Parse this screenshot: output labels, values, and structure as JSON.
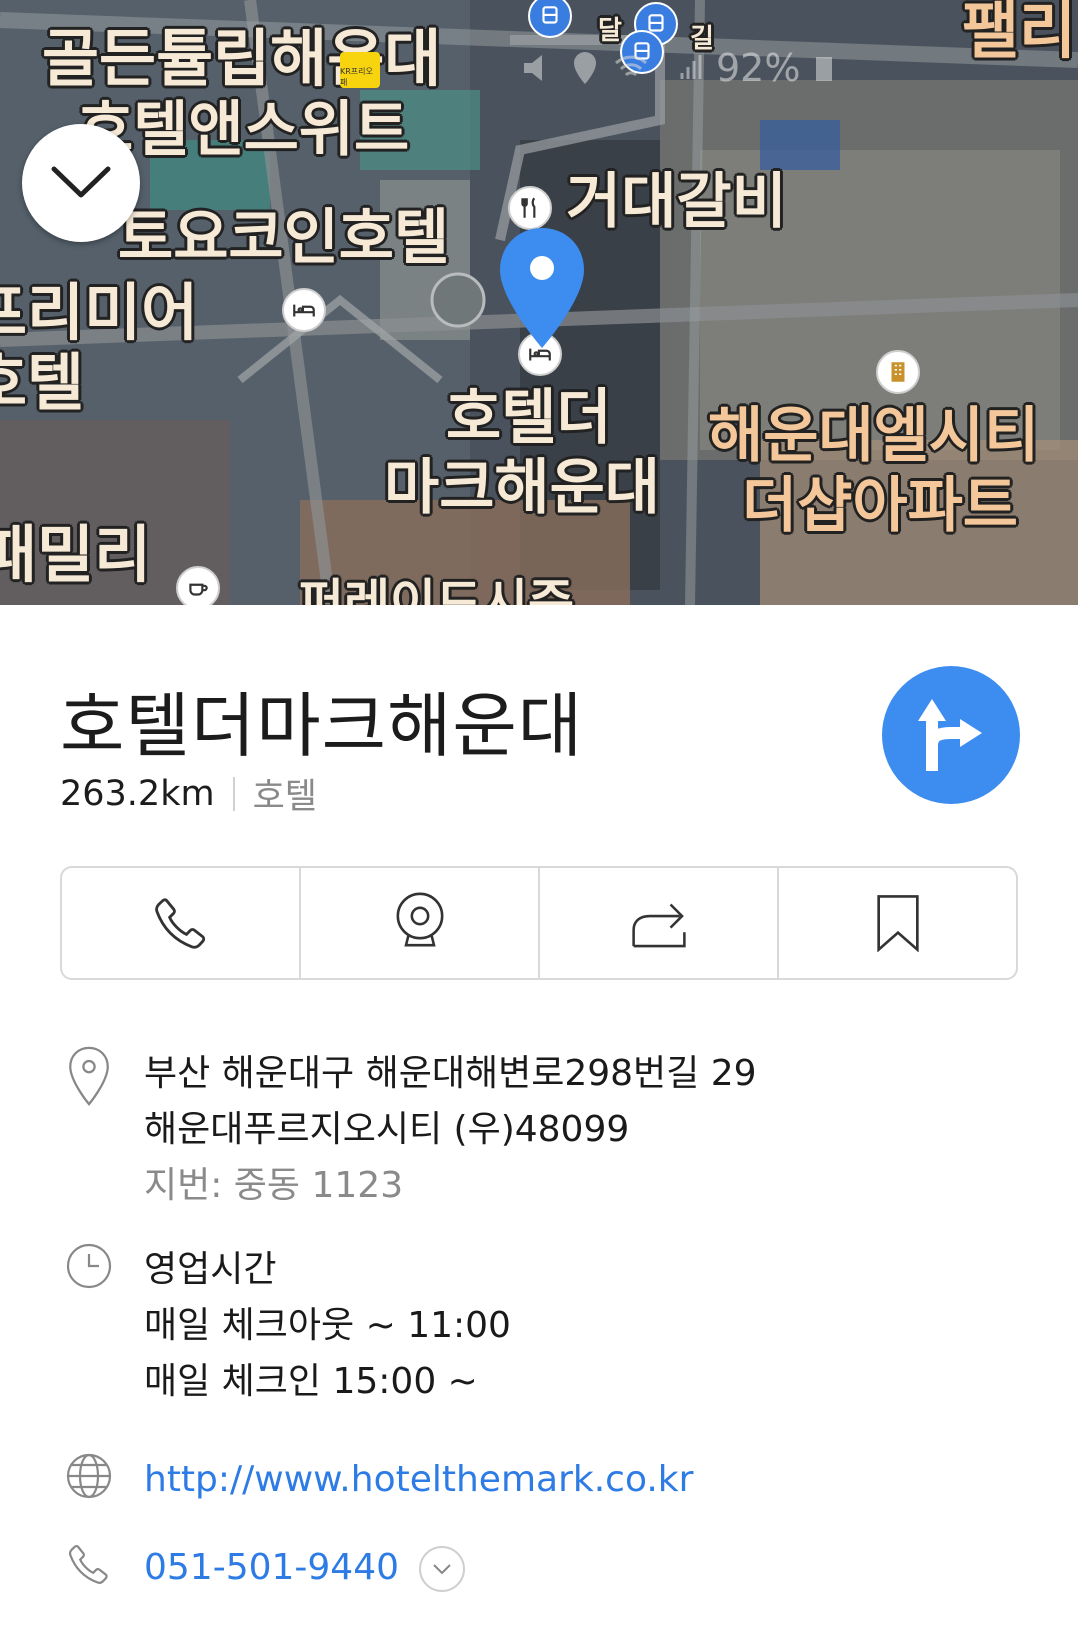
{
  "map": {
    "labels": [
      {
        "id": "golden-tulip-line1",
        "text": "골든튤립해운대"
      },
      {
        "id": "golden-tulip-line2",
        "text": "호텔앤스위트"
      },
      {
        "id": "toyoko-inn",
        "text": "토요코인호텔"
      },
      {
        "id": "premier-line1",
        "text": "프리미어"
      },
      {
        "id": "premier-line2",
        "text": "호텔"
      },
      {
        "id": "geodae-galbi",
        "text": "거대갈비"
      },
      {
        "id": "hotel-the-mark-line1",
        "text": "호텔더"
      },
      {
        "id": "hotel-the-mark-line2",
        "text": "마크해운대"
      },
      {
        "id": "elcity-line1",
        "text": "해운대엘시티"
      },
      {
        "id": "elcity-line2",
        "text": "더샵아파트"
      },
      {
        "id": "family",
        "text": "패밀리"
      },
      {
        "id": "palace",
        "text": "팰리"
      },
      {
        "id": "road-dal",
        "text": "달"
      },
      {
        "id": "road-gil",
        "text": "길"
      },
      {
        "id": "parade",
        "text": "퍼레이드시즌"
      }
    ],
    "status": {
      "battery": "92%"
    },
    "chip_text": "KR프리오패"
  },
  "place": {
    "name": "호텔더마크해운대",
    "distance": "263.2km",
    "category": "호텔"
  },
  "actions": [
    {
      "id": "call",
      "icon": "phone-icon"
    },
    {
      "id": "roadview",
      "icon": "webcam-icon"
    },
    {
      "id": "share",
      "icon": "share-icon"
    },
    {
      "id": "save",
      "icon": "bookmark-icon"
    }
  ],
  "info": {
    "address_line1": "부산 해운대구 해운대해변로298번길 29",
    "address_line2": "해운대푸르지오시티 (우)48099",
    "lot_address": "지번: 중동 1123",
    "hours_title": "영업시간",
    "hours_checkout": "매일 체크아웃 ~ 11:00",
    "hours_checkin": "매일 체크인 15:00 ~",
    "website": "http://www.hotelthemark.co.kr",
    "phone": "051-501-9440"
  },
  "colors": {
    "accent": "#3d8cf0",
    "link": "#2d7be5"
  }
}
